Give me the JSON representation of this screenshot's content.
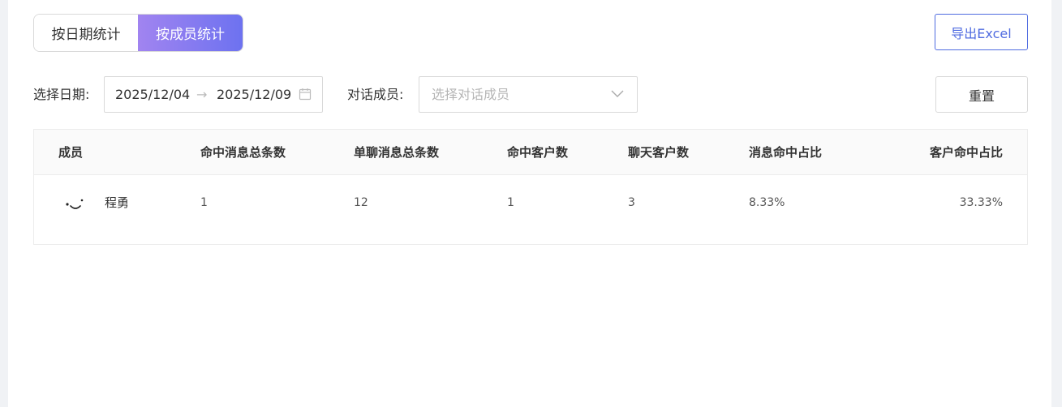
{
  "toggle": {
    "by_date": "按日期统计",
    "by_member": "按成员统计",
    "active": "by_member"
  },
  "actions": {
    "export_label": "导出Excel",
    "reset_label": "重置"
  },
  "filters": {
    "date_label": "选择日期:",
    "date_start": "2025/12/04",
    "date_arrow": "→",
    "date_end": "2025/12/09",
    "member_label": "对话成员:",
    "member_placeholder": "选择对话成员"
  },
  "table": {
    "headers": [
      "成员",
      "命中消息总条数",
      "单聊消息总条数",
      "命中客户数",
      "聊天客户数",
      "消息命中占比",
      "客户命中占比"
    ],
    "rows": [
      {
        "member": "程勇",
        "hit_msgs": "1",
        "single_msgs": "12",
        "hit_customers": "1",
        "chat_customers": "3",
        "msg_hit_ratio": "8.33%",
        "customer_hit_ratio": "33.33%"
      }
    ]
  },
  "colors": {
    "accent": "#4f6be0",
    "toggle_gradient_start": "#a184f0",
    "toggle_gradient_end": "#6d72f0"
  }
}
